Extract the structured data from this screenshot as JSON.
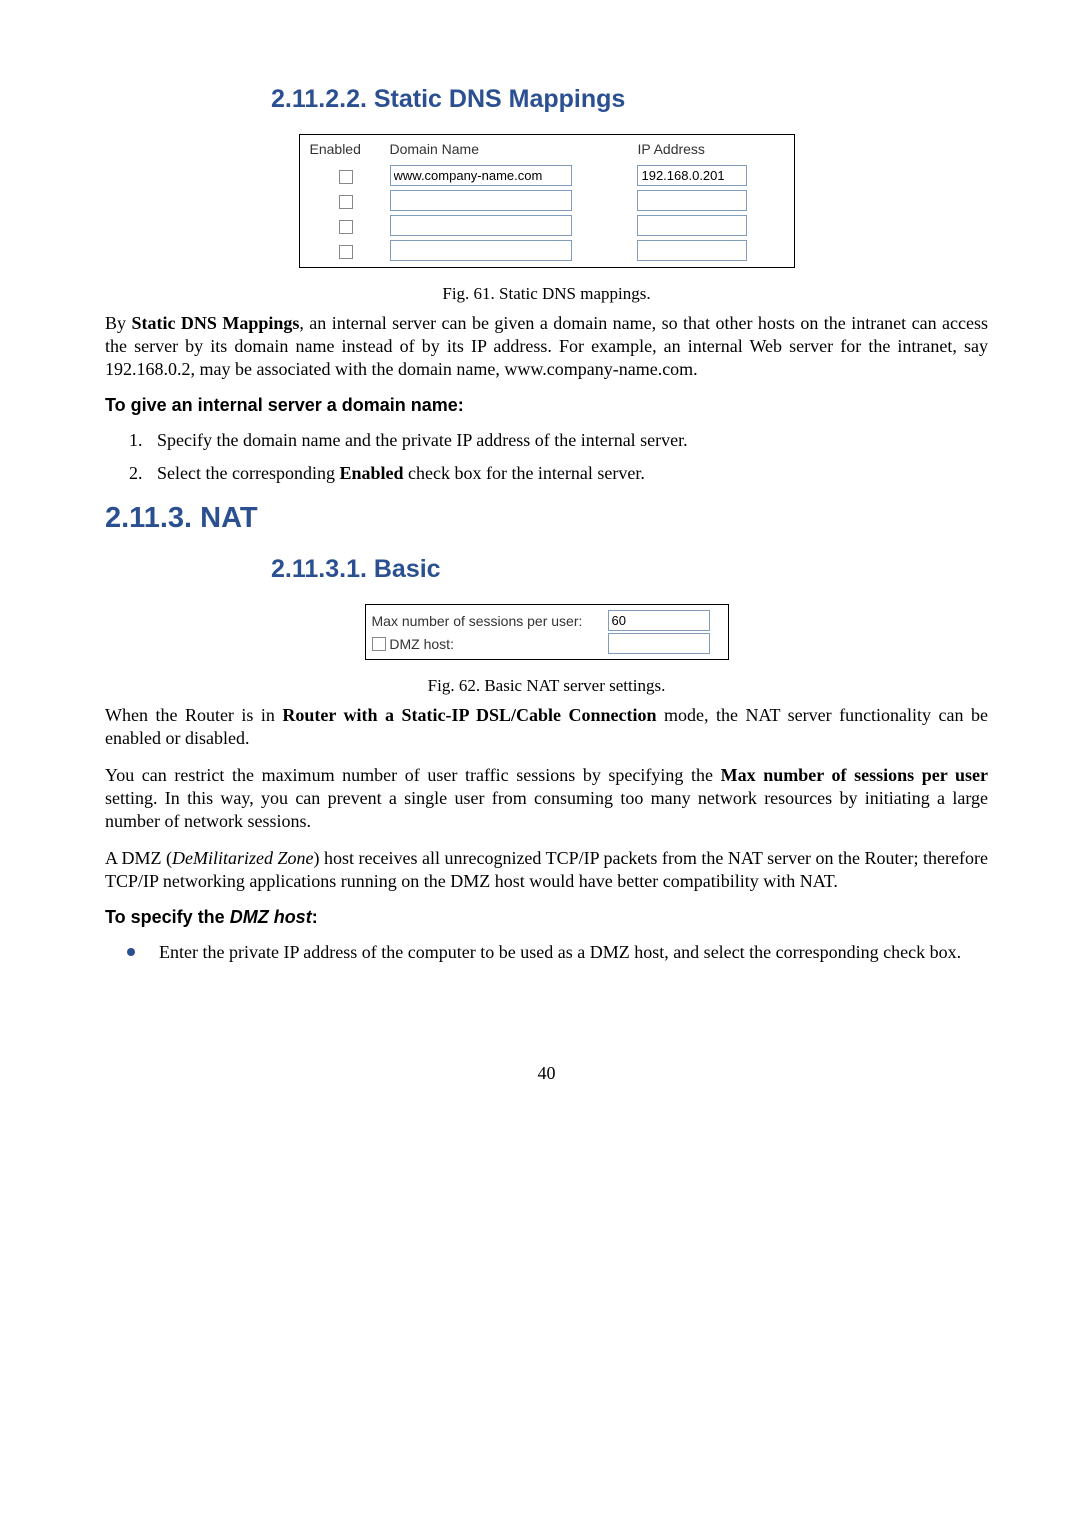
{
  "sec1_title": "2.11.2.2. Static DNS Mappings",
  "ss1": {
    "col1": "Enabled",
    "col2": "Domain Name",
    "col3": "IP Address",
    "rows": [
      {
        "domain": "www.company-name.com",
        "ip": "192.168.0.201"
      },
      {
        "domain": "",
        "ip": ""
      },
      {
        "domain": "",
        "ip": ""
      },
      {
        "domain": "",
        "ip": ""
      }
    ]
  },
  "fig61": "Fig. 61. Static DNS mappings.",
  "p1a": "By ",
  "p1b": "Static DNS Mappings",
  "p1c": ", an internal server can be given a domain name, so that other hosts on the intranet can access the server by its domain name instead of by its IP address. For example, an internal Web server for the intranet, say 192.168.0.2, may be associated with the domain name, www.company-name.com.",
  "h3a": "To give an internal server a domain name:",
  "li1": "Specify the domain name and the private IP address of the internal server.",
  "li2a": "Select the corresponding ",
  "li2b": "Enabled",
  "li2c": " check box for the internal server.",
  "sec2_title": "2.11.3. NAT",
  "sec3_title": "2.11.3.1. Basic",
  "ss2": {
    "row1_label": "Max number of sessions per user:",
    "row1_value": "60",
    "row2_label": " DMZ host:",
    "row2_value": ""
  },
  "fig62": "Fig. 62. Basic NAT server settings.",
  "p2a": "When the Router is in ",
  "p2b": "Router with a Static-IP DSL/Cable Connection",
  "p2c": " mode, the NAT server functionality can be enabled or disabled.",
  "p3a": "You can restrict the maximum number of user traffic sessions by specifying the ",
  "p3b": "Max number of sessions per user",
  "p3c": " setting. In this way, you can prevent a single user from consuming too many network resources by initiating a large number of network sessions.",
  "p4a": "A DMZ (",
  "p4b": "DeMilitarized Zone",
  "p4c": ") host receives all unrecognized TCP/IP packets from the NAT server on the Router; therefore TCP/IP networking applications running on the DMZ host would have better compatibility with NAT.",
  "h3b_a": "To specify the ",
  "h3b_b": "DMZ host",
  "h3b_c": ":",
  "bullet1": "Enter the private IP address of the computer to be used as a DMZ host, and select the corresponding check box.",
  "pagenum": "40"
}
